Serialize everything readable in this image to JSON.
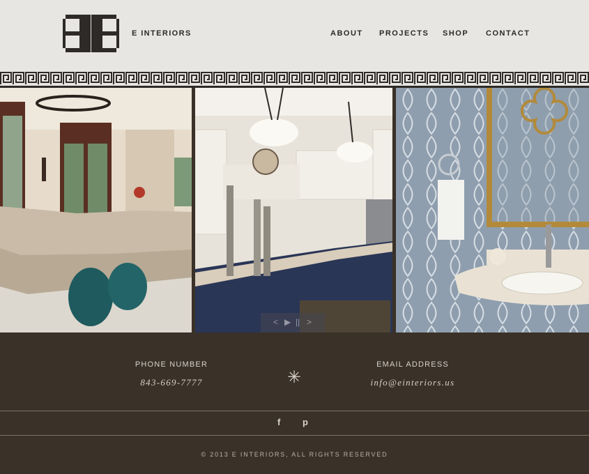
{
  "header": {
    "brand": "E INTERIORS",
    "nav": [
      "ABOUT",
      "PROJECTS",
      "SHOP",
      "CONTACT"
    ]
  },
  "gallery": {
    "slider_controls": [
      "<",
      "▶",
      "||",
      ">"
    ]
  },
  "footer": {
    "phone_label": "PHONE NUMBER",
    "phone_value": "843-669-7777",
    "divider_symbol": "✳",
    "email_label": "EMAIL ADDRESS",
    "email_value": "info@einteriors.us",
    "social": [
      "f",
      "p"
    ],
    "copyright": "© 2013 E INTERIORS, ALL RIGHTS RESERVED"
  },
  "colors": {
    "header_bg": "#e8e6e3",
    "footer_bg": "#3a3128",
    "text_dark": "#2d2a27",
    "text_light": "#d8d3cc"
  }
}
